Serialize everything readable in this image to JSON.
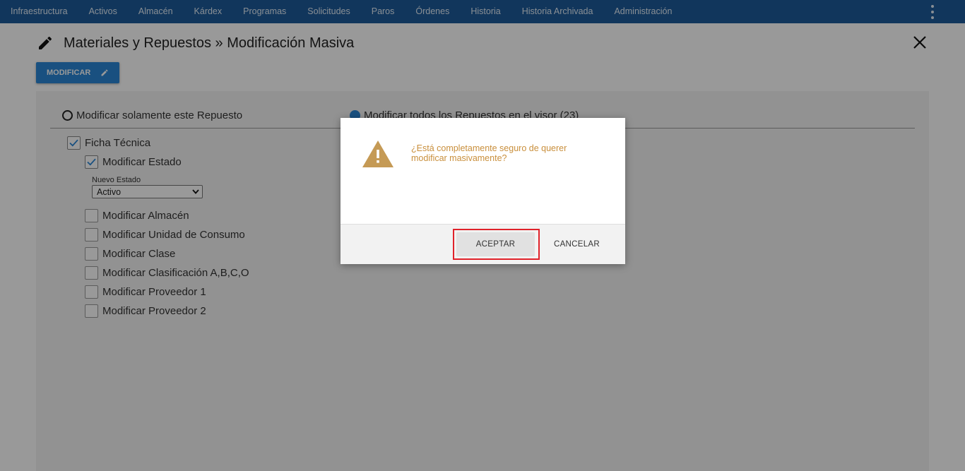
{
  "nav": {
    "items": [
      "Infraestructura",
      "Activos",
      "Almacén",
      "Kárdex",
      "Programas",
      "Solicitudes",
      "Paros",
      "Órdenes",
      "Historia",
      "Historia Archivada",
      "Administración"
    ]
  },
  "header": {
    "title": "Materiales y Repuestos » Modificación Masiva",
    "modify_label": "MODIFICAR"
  },
  "scope": {
    "option_single": "Modificar solamente este Repuesto",
    "option_all": "Modificar todos los Repuestos en el visor (23)",
    "selected": "all"
  },
  "form": {
    "ficha_tecnica": {
      "label": "Ficha Técnica",
      "checked": true
    },
    "modificar_estado": {
      "label": "Modificar Estado",
      "checked": true
    },
    "nuevo_estado": {
      "label": "Nuevo Estado",
      "value": "Activo"
    },
    "options": [
      {
        "label": "Modificar Almacén",
        "checked": false
      },
      {
        "label": "Modificar Unidad de Consumo",
        "checked": false
      },
      {
        "label": "Modificar Clase",
        "checked": false
      },
      {
        "label": "Modificar Clasificación A,B,C,O",
        "checked": false
      },
      {
        "label": "Modificar Proveedor 1",
        "checked": false
      },
      {
        "label": "Modificar Proveedor 2",
        "checked": false
      }
    ]
  },
  "dialog": {
    "message": "¿Está completamente seguro de querer modificar masivamente?",
    "accept_label": "ACEPTAR",
    "cancel_label": "CANCELAR",
    "icon": "warning-icon",
    "accent_color": "#c59a55"
  },
  "colors": {
    "nav_bg": "#1d5b9a",
    "primary": "#2a86d6",
    "highlight": "#e0222a"
  }
}
